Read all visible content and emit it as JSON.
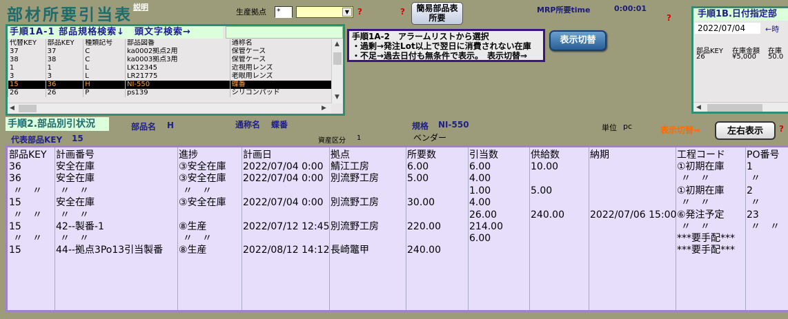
{
  "header": {
    "title": "部材所要引当表",
    "setsumei": "説明",
    "base_label": "生産拠点",
    "base_code": "*",
    "base_select": "",
    "q1": "?",
    "q2": "?",
    "kani_button": "簡易部品表\n所要",
    "mrp_label": "MRP所要time",
    "mrp_time": "0:00:01",
    "q3": "?"
  },
  "step1a": {
    "header": "手順1A-1 部品規格検索↓　頭文字検索→",
    "search_value": "",
    "columns": [
      "代替KEY",
      "部品KEY",
      "種類記号",
      "部品図番",
      "通称名"
    ],
    "rows": [
      [
        "37",
        "37",
        "C",
        "ka0002拠点2用",
        "保管ケース"
      ],
      [
        "38",
        "38",
        "C",
        "ka0003拠点3用",
        "保管ケース"
      ],
      [
        "1",
        "1",
        "L",
        "LK12345",
        "近視用レンズ"
      ],
      [
        "3",
        "3",
        "L",
        "LR21775",
        "老眼用レンズ"
      ],
      [
        "15",
        "36",
        "H",
        "NI-550",
        "蝶番"
      ],
      [
        "26",
        "26",
        "P",
        "ps139",
        "シリコンパッド"
      ]
    ],
    "selected_row_index": 4
  },
  "alarm": {
    "line1": "手順1A-2　アラームリストから選択",
    "line2": "・過剰→発注Lot以上で翌日に消費されない在庫",
    "line3": "・不足→過去日付も無条件で表示。　表示切替⇒",
    "toggle_button": "表示切替"
  },
  "step1b": {
    "header": "手順1B.日付指定部",
    "date": "2022/07/04",
    "date_hint": "←時",
    "columns": [
      "部品KEY",
      "在庫金額",
      "在庫"
    ],
    "rows": [
      [
        "26",
        "¥5,000",
        "50.0"
      ]
    ]
  },
  "step2": {
    "header": "手順2.部品別引状況",
    "part_name_label": "部品名",
    "part_name": "H",
    "common_name_label": "通称名",
    "common_name": "蝶番",
    "spec_label": "規格",
    "spec": "NI-550",
    "unit_label": "単位",
    "unit": "pc",
    "toggle_label": "表示切替⇒",
    "lr_button": "左右表示",
    "q": "?",
    "rep_key_label": "代表部品KEY",
    "rep_key": "15",
    "asset_label": "資産区分",
    "asset": "1",
    "vendor_label": "ベンダー"
  },
  "table": {
    "columns": [
      "部品KEY",
      "計画番号",
      "進捗",
      "計画日",
      "拠点",
      "所要数",
      "引当数",
      "供給数",
      "納期",
      "工程コード",
      "PO番号"
    ],
    "rows": [
      [
        "36",
        "安全在庫",
        "③安全在庫",
        "2022/07/04 0:00",
        "鯖江工房",
        "6.00",
        "6.00",
        "10.00",
        "",
        "①初期在庫",
        "1"
      ],
      [
        "36",
        "安全在庫",
        "③安全在庫",
        "2022/07/04 0:00",
        "別流野工房",
        "5.00",
        "4.00",
        "",
        "",
        "〃　〃",
        "〃"
      ],
      [
        "〃　〃",
        "〃　〃",
        "〃　〃",
        "",
        "",
        "",
        "1.00",
        "5.00",
        "",
        "①初期在庫",
        "2"
      ],
      [
        "15",
        "安全在庫",
        "③安全在庫",
        "2022/07/04 0:00",
        "別流野工房",
        "30.00",
        "4.00",
        "",
        "",
        "〃　〃",
        "〃"
      ],
      [
        "〃　〃",
        "〃　〃",
        "",
        "",
        "",
        "",
        "26.00",
        "240.00",
        "2022/07/06 15:00",
        "⑥発注予定",
        "23"
      ],
      [
        "15",
        "42--製番-1",
        "⑧生産",
        "2022/07/12 12:45",
        "別流野工房",
        "220.00",
        "214.00",
        "",
        "",
        "〃　〃",
        "〃　〃"
      ],
      [
        "〃　〃",
        "〃　〃",
        "〃　〃",
        "",
        "",
        "",
        "6.00",
        "",
        "",
        "***要手配***",
        ""
      ],
      [
        "15",
        "44--拠点3Po13引当製番",
        "⑧生産",
        "2022/08/12 14:12",
        "長崎鼈甲",
        "240.00",
        "",
        "",
        "",
        "***要手配***",
        ""
      ]
    ]
  },
  "colors": {
    "background": "#9c9c7a",
    "title": "#1f6b6b",
    "panel_border_green": "#2d8f72",
    "panel_border_purple": "#a080d0",
    "selected_row_text": "#ffa040",
    "alert_red": "#e00000",
    "toggle_orange": "#ff6a00"
  }
}
